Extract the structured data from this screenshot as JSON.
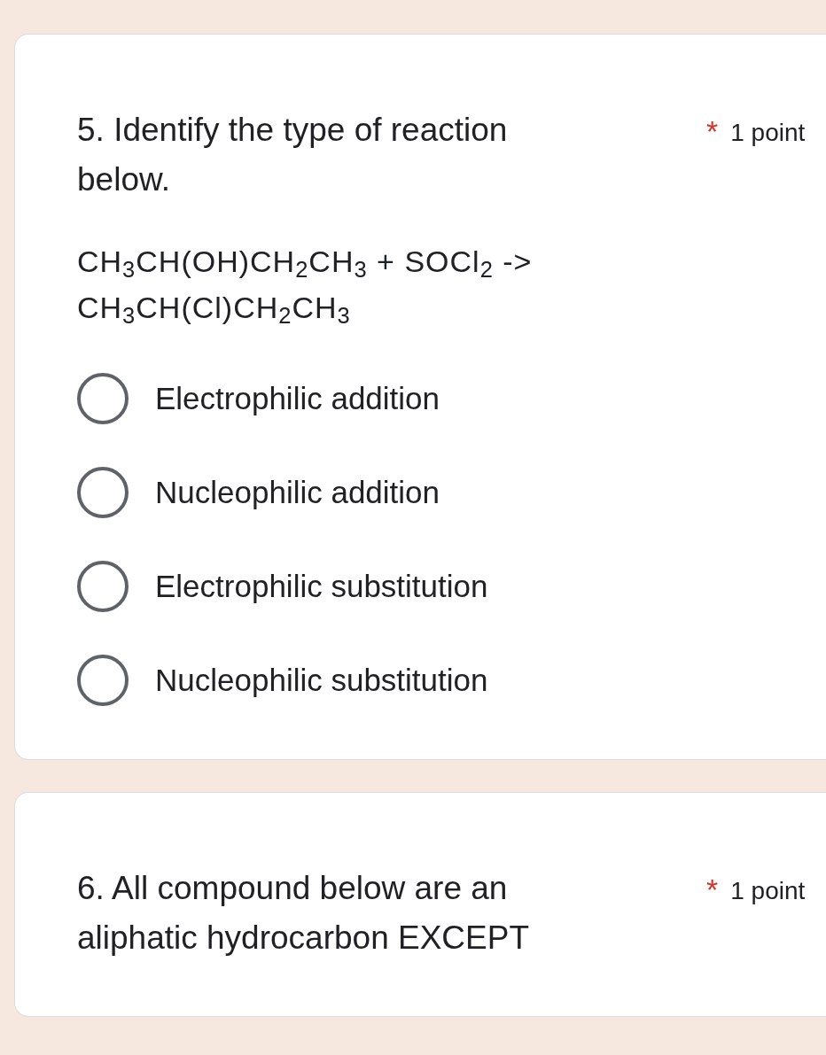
{
  "questions": [
    {
      "title": "5. Identify the type of reaction below.",
      "required_mark": "*",
      "points": "1 point",
      "equation_lines": [
        "CH$_{3}$CH(OH)CH$_{2}$CH$_{3}$ + SOCl$_{2}$ ->",
        "CH$_{3}$CH(Cl)CH$_{2}$CH$_{3}$"
      ],
      "options": [
        {
          "label": "Electrophilic addition",
          "selected": false
        },
        {
          "label": "Nucleophilic addition",
          "selected": false
        },
        {
          "label": "Electrophilic substitution",
          "selected": false
        },
        {
          "label": "Nucleophilic substitution",
          "selected": false
        }
      ]
    },
    {
      "title": "6. All compound below are an aliphatic hydrocarbon EXCEPT",
      "required_mark": "*",
      "points": "1 point"
    }
  ]
}
